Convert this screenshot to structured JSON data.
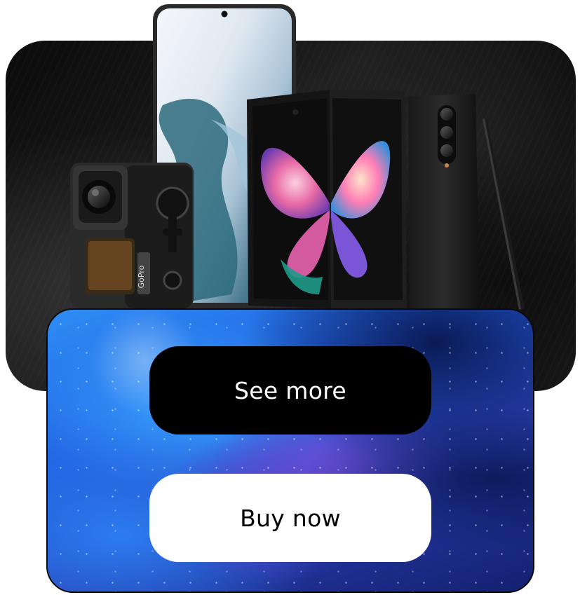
{
  "buttons": {
    "see_more": "See more",
    "buy_now": "Buy now"
  },
  "products": {
    "camera_brand": "GoPro"
  },
  "colors": {
    "dark_card": "#0f0f0f",
    "button_dark": "#000000",
    "button_light": "#ffffff",
    "panel_blue": "#2a5fe0",
    "panel_purple": "#6b4fd8"
  },
  "icons": [
    "action-camera-icon",
    "smartphone-icon",
    "foldable-phone-icon",
    "stylus-pen-icon"
  ]
}
